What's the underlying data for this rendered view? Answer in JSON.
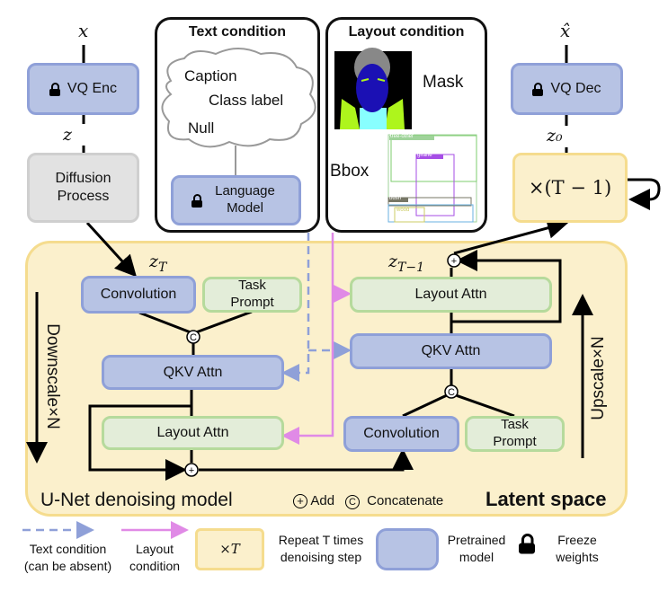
{
  "inputs": {
    "x": "x",
    "x_hat": "x̂",
    "z": "z",
    "z0": "z₀",
    "zT": "z",
    "zT_sub": "T",
    "zT1": "z",
    "zT1_sub": "T−1"
  },
  "vq_enc": "VQ Enc",
  "vq_dec": "VQ Dec",
  "diffusion": "Diffusion Process",
  "text_condition": {
    "title": "Text condition",
    "caption": "Caption",
    "class_label": "Class label",
    "null": "Null",
    "language_model": "Language Model"
  },
  "layout_condition": {
    "title": "Layout condition",
    "mask": "Mask",
    "bbox": "Bbox",
    "bbox_labels": [
      "tree-other",
      "giraffe",
      "bush",
      "wood"
    ]
  },
  "repeat_box": "×(T − 1)",
  "unet": {
    "convolution": "Convolution",
    "task_prompt": "Task Prompt",
    "qkv_attn": "QKV Attn",
    "layout_attn": "Layout Attn",
    "downscale": "Downscale×N",
    "upscale": "Upscale×N",
    "title": "U-Net denoising model",
    "add": "Add",
    "concatenate": "Concatenate",
    "latent_space": "Latent space",
    "concat_symbol": "C",
    "add_symbol": "+"
  },
  "legend": {
    "text_condition": "Text condition (can be absent)",
    "layout_condition": "Layout condition",
    "xT": "×T",
    "repeat": "Repeat T times denoising step",
    "pretrained": "Pretrained model",
    "freeze": "Freeze weights"
  },
  "colors": {
    "pretrained": "#b7c3e4",
    "trainable": "#e3edd9",
    "latent": "#fbf0cc",
    "text_arrow": "#8fa0d8",
    "layout_arrow": "#e08ae6"
  }
}
